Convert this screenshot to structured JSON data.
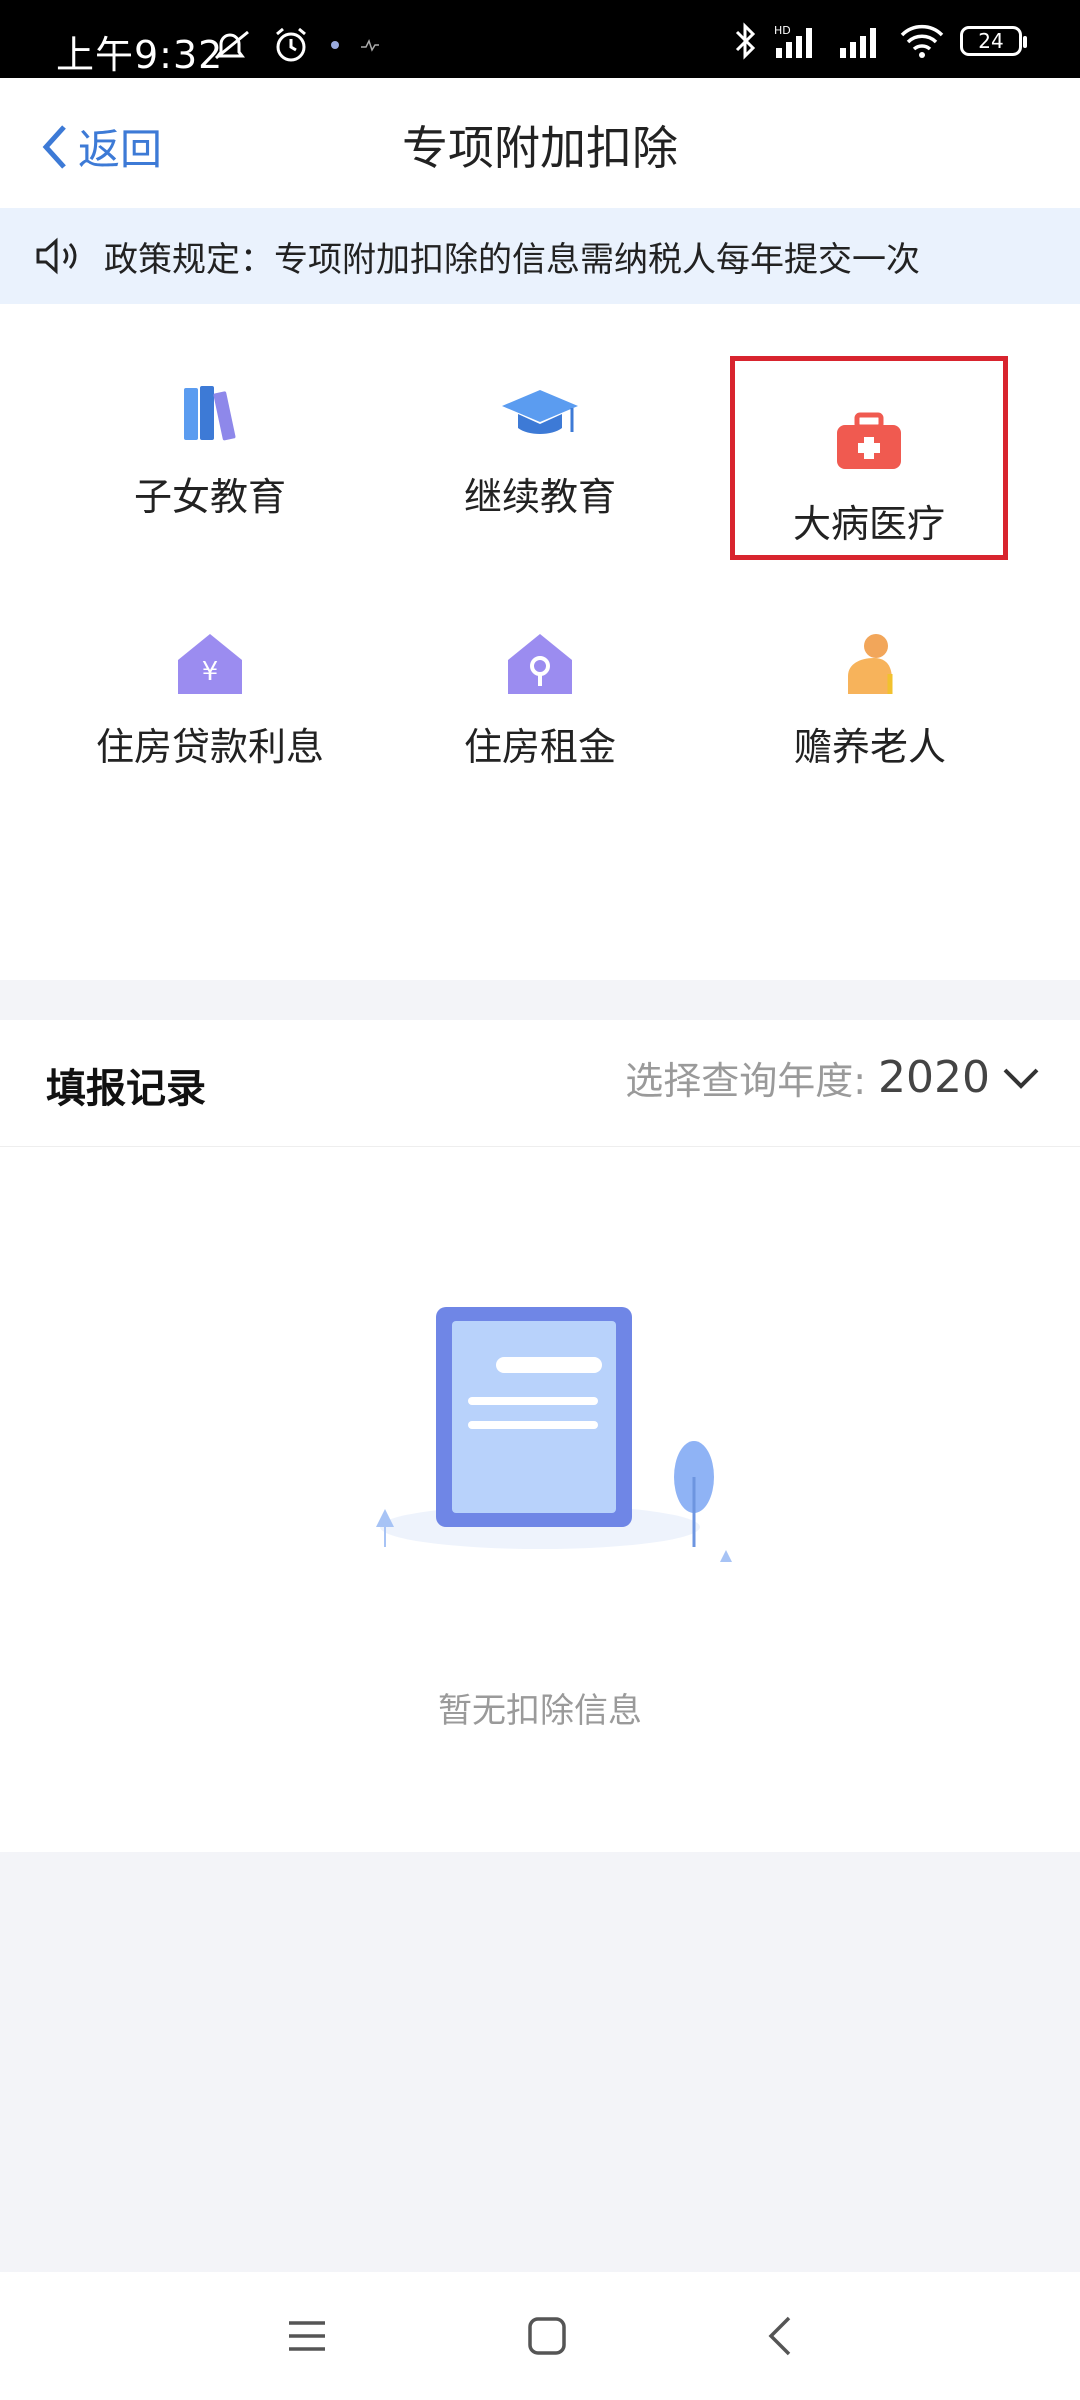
{
  "status_bar": {
    "time": "上午9:32",
    "battery": "24"
  },
  "nav": {
    "back_label": "返回",
    "title": "专项附加扣除"
  },
  "notice": {
    "text": "政策规定：专项附加扣除的信息需纳税人每年提交一次"
  },
  "categories": [
    {
      "label": "子女教育",
      "icon": "books-icon"
    },
    {
      "label": "继续教育",
      "icon": "graduation-cap-icon"
    },
    {
      "label": "大病医疗",
      "icon": "medical-kit-icon",
      "highlighted": true
    },
    {
      "label": "住房贷款利息",
      "icon": "house-yuan-icon"
    },
    {
      "label": "住房租金",
      "icon": "house-key-icon"
    },
    {
      "label": "赡养老人",
      "icon": "elder-person-icon"
    }
  ],
  "records": {
    "title": "填报记录",
    "year_label": "选择查询年度:",
    "year_value": "2020",
    "empty_text": "暂无扣除信息"
  },
  "colors": {
    "accent": "#3d7ad6",
    "highlight_border": "#d8242e",
    "notice_bg": "#eaf2fd"
  }
}
